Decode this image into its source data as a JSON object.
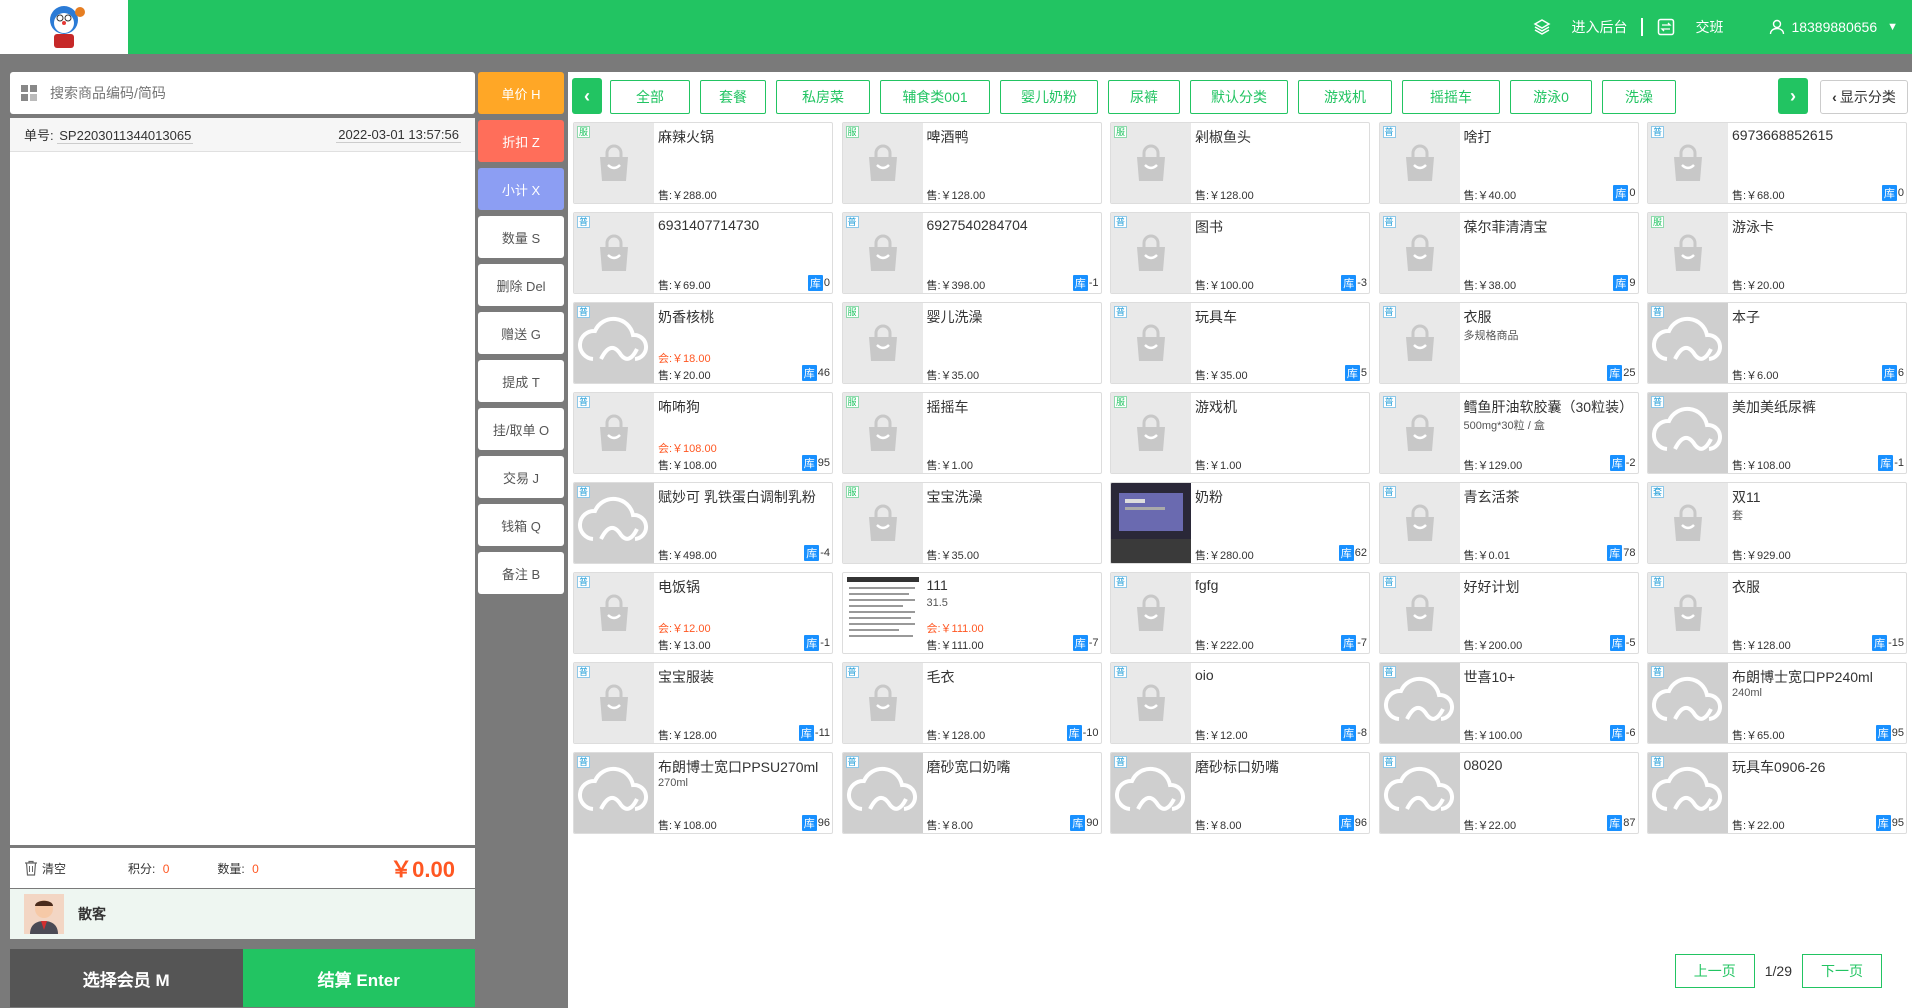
{
  "header": {
    "enter_backend": "进入后台",
    "shift": "交班",
    "user_phone": "18389880656"
  },
  "search": {
    "placeholder": "搜索商品编码/简码"
  },
  "order": {
    "no_label": "单号:",
    "no_value": "SP2203011344013065",
    "datetime": "2022-03-01 13:57:56"
  },
  "summary": {
    "clear": "清空",
    "points_label": "积分:",
    "points": "0",
    "qty_label": "数量:",
    "qty": "0",
    "total": "￥0.00"
  },
  "member": {
    "name": "散客"
  },
  "buttons": {
    "select_member": "选择会员 M",
    "checkout": "结算 Enter"
  },
  "actions": [
    {
      "label": "单价 H",
      "color": "#ffa726"
    },
    {
      "label": "折扣 Z",
      "color": "#ff6e5a"
    },
    {
      "label": "小计 X",
      "color": "#8c9ef3"
    },
    {
      "label": "数量 S"
    },
    {
      "label": "删除 Del"
    },
    {
      "label": "赠送 G"
    },
    {
      "label": "提成 T"
    },
    {
      "label": "挂/取单 O"
    },
    {
      "label": "交易 J"
    },
    {
      "label": "钱箱 Q"
    },
    {
      "label": "备注 B"
    }
  ],
  "categories": [
    "全部",
    "套餐",
    "私房菜",
    "辅食类001",
    "婴儿奶粉",
    "尿裤",
    "默认分类",
    "游戏机",
    "摇摇车",
    "游泳0",
    "洗澡"
  ],
  "show_category": "显示分类",
  "colors": {
    "accent": "#22c462",
    "stock_badge": "#1890ff",
    "price_red": "#ff5722"
  },
  "products": [
    {
      "name": "麻辣火锅",
      "price": "售:￥288.00",
      "tag": "服",
      "img": "bag"
    },
    {
      "name": "啤酒鸭",
      "price": "售:￥128.00",
      "tag": "服",
      "img": "bag"
    },
    {
      "name": "剁椒鱼头",
      "price": "售:￥128.00",
      "tag": "服",
      "img": "bag"
    },
    {
      "name": "啥打",
      "price": "售:￥40.00",
      "stock": "0",
      "tag": "普",
      "img": "bag"
    },
    {
      "name": "6973668852615",
      "price": "售:￥68.00",
      "stock": "0",
      "tag": "普",
      "img": "bag"
    },
    {
      "name": "6931407714730",
      "price": "售:￥69.00",
      "stock": "0",
      "tag": "普",
      "img": "bag"
    },
    {
      "name": "6927540284704",
      "price": "售:￥398.00",
      "stock": "-1",
      "tag": "普",
      "img": "bag"
    },
    {
      "name": "图书",
      "price": "售:￥100.00",
      "stock": "-3",
      "tag": "普",
      "img": "bag"
    },
    {
      "name": "葆尔菲清清宝",
      "price": "售:￥38.00",
      "stock": "9",
      "tag": "普",
      "img": "bag"
    },
    {
      "name": "游泳卡",
      "price": "售:￥20.00",
      "tag": "服",
      "img": "bag"
    },
    {
      "name": "奶香核桃",
      "member_price": "会:￥18.00",
      "price": "售:￥20.00",
      "stock": "46",
      "tag": "普",
      "img": "cloud"
    },
    {
      "name": "婴儿洗澡",
      "price": "售:￥35.00",
      "tag": "服",
      "img": "bag"
    },
    {
      "name": "玩具车",
      "price": "售:￥35.00",
      "stock": "5",
      "tag": "普",
      "img": "bag"
    },
    {
      "name": "衣服",
      "extra": "多规格商品",
      "stock": "25",
      "tag": "普",
      "img": "bag"
    },
    {
      "name": "本子",
      "price": "售:￥6.00",
      "stock": "6",
      "tag": "普",
      "img": "cloud"
    },
    {
      "name": "咘咘狗",
      "member_price": "会:￥108.00",
      "price": "售:￥108.00",
      "stock": "95",
      "tag": "普",
      "img": "bag"
    },
    {
      "name": "摇摇车",
      "price": "售:￥1.00",
      "tag": "服",
      "img": "bag"
    },
    {
      "name": "游戏机",
      "price": "售:￥1.00",
      "tag": "服",
      "img": "bag"
    },
    {
      "name": "鳕鱼肝油软胶囊（30粒装）",
      "extra": "500mg*30粒 / 盒",
      "price": "售:￥129.00",
      "stock": "-2",
      "tag": "普",
      "img": "bag"
    },
    {
      "name": "美加美纸尿裤",
      "price": "售:￥108.00",
      "stock": "-1",
      "tag": "普",
      "img": "cloud"
    },
    {
      "name": "赋妙可 乳铁蛋白调制乳粉",
      "price": "售:￥498.00",
      "stock": "-4",
      "tag": "普",
      "img": "cloud"
    },
    {
      "name": "宝宝洗澡",
      "price": "售:￥35.00",
      "tag": "服",
      "img": "bag"
    },
    {
      "name": "奶粉",
      "price": "售:￥280.00",
      "stock": "62",
      "tag": "",
      "img": "photo"
    },
    {
      "name": "青玄活茶",
      "price": "售:￥0.01",
      "stock": "78",
      "tag": "普",
      "img": "bag"
    },
    {
      "name": "双11",
      "extra": "套",
      "price": "售:￥929.00",
      "tag": "套",
      "img": "bag"
    },
    {
      "name": "电饭锅",
      "member_price": "会:￥12.00",
      "price": "售:￥13.00",
      "stock": "-1",
      "tag": "普",
      "img": "bag"
    },
    {
      "name": "111",
      "extra": "31.5",
      "member_price": "会:￥111.00",
      "price": "售:￥111.00",
      "stock": "-7",
      "tag": "",
      "img": "doc"
    },
    {
      "name": "fgfg",
      "price": "售:￥222.00",
      "stock": "-7",
      "tag": "普",
      "img": "bag"
    },
    {
      "name": "好好计划",
      "price": "售:￥200.00",
      "stock": "-5",
      "tag": "普",
      "img": "bag"
    },
    {
      "name": "衣服",
      "price": "售:￥128.00",
      "stock": "-15",
      "tag": "普",
      "img": "bag"
    },
    {
      "name": "宝宝服装",
      "price": "售:￥128.00",
      "stock": "-11",
      "tag": "普",
      "img": "bag"
    },
    {
      "name": "毛衣",
      "price": "售:￥128.00",
      "stock": "-10",
      "tag": "普",
      "img": "bag"
    },
    {
      "name": "oio",
      "price": "售:￥12.00",
      "stock": "-8",
      "tag": "普",
      "img": "bag"
    },
    {
      "name": "世喜10+",
      "price": "售:￥100.00",
      "stock": "-6",
      "tag": "普",
      "img": "cloud"
    },
    {
      "name": "布朗博士宽口PP240ml",
      "extra": "240ml",
      "price": "售:￥65.00",
      "stock": "95",
      "tag": "普",
      "img": "cloud"
    },
    {
      "name": "布朗博士宽口PPSU270ml",
      "extra": "270ml",
      "price": "售:￥108.00",
      "stock": "96",
      "tag": "普",
      "img": "cloud"
    },
    {
      "name": "磨砂宽口奶嘴",
      "price": "售:￥8.00",
      "stock": "90",
      "tag": "普",
      "img": "cloud"
    },
    {
      "name": "磨砂标口奶嘴",
      "price": "售:￥8.00",
      "stock": "96",
      "tag": "普",
      "img": "cloud"
    },
    {
      "name": "08020",
      "price": "售:￥22.00",
      "stock": "87",
      "tag": "普",
      "img": "cloud"
    },
    {
      "name": "玩具车0906-26",
      "price": "售:￥22.00",
      "stock": "95",
      "tag": "普",
      "img": "cloud"
    }
  ],
  "stock_label": "库",
  "pager": {
    "prev": "上一页",
    "page": "1/29",
    "next": "下一页"
  }
}
